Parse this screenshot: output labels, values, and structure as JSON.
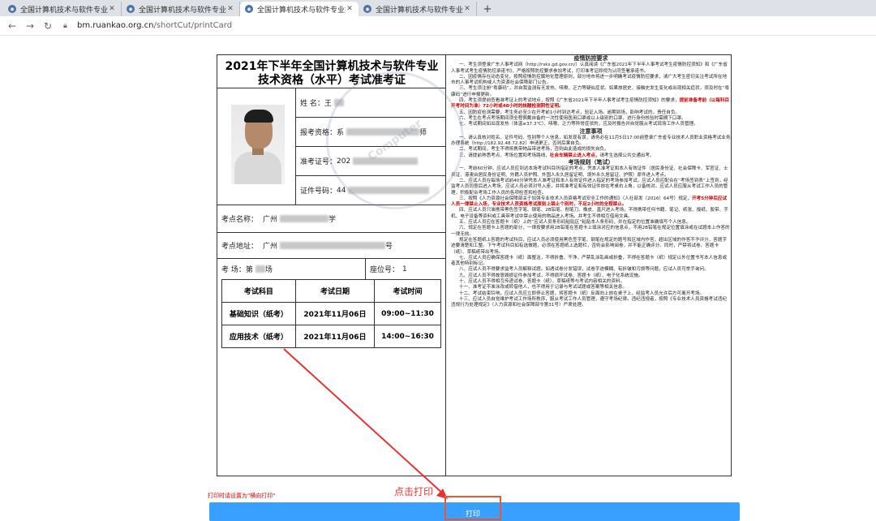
{
  "browser": {
    "tabs": [
      {
        "title": "全国计算机技术与软件专业技术"
      },
      {
        "title": "全国计算机技术与软件专业技术"
      },
      {
        "title": "全国计算机技术与软件专业技术"
      },
      {
        "title": "全国计算机技术与软件专业技术"
      }
    ],
    "new_tab": "+",
    "url_domain": "bm.ruankao.org.cn",
    "url_path": "/shortCut/printCard"
  },
  "card": {
    "title": "2021年下半年全国计算机技术与软件专业技术资格（水平）考试准考证",
    "name_label": "姓  名：",
    "name_value": "王",
    "qualification_label": "报考资格：",
    "qualification_value": "系",
    "qualification_tail": "师",
    "admission_label": "准考证号：",
    "admission_value": "202",
    "id_label": "证件号码：",
    "id_value": "44",
    "site_name_label": "考点名称：",
    "site_name_value": "广州",
    "site_name_tail": "学",
    "site_addr_label": "考点地址：",
    "site_addr_value": "广州",
    "site_addr_tail": "号",
    "room_label": "考   场：",
    "room_value": "第",
    "room_tail": "场",
    "seat_label": "座位号：",
    "seat_value": "1",
    "exam_table": {
      "headers": [
        "考试科目",
        "考试日期",
        "考试时间"
      ],
      "rows": [
        [
          "基础知识（纸考）",
          "2021年11月06日",
          "09:00~11:30"
        ],
        [
          "应用技术（纸考）",
          "2021年11月06日",
          "14:00~16:30"
        ]
      ]
    }
  },
  "notice": {
    "h1": "疫情防控要求",
    "h2": "注意事项",
    "h3": "考场规则（笔试）",
    "p1": "一、考生须登录广东人事考试网（http://rsks.gd.gov.cn/）认真阅读《广东省2021年下半年人事考试考生疫情防控须知》和《广东省人事考试考生疫情防控承诺书》，严格按照防控要求参加考试，打印准考证即视为认同签署承诺书。",
    "p2": "二、因疫情存在动态变化，按照疫情防控属地化管理原则，部分地市将进一步明确考试疫情防控要求，请广大考生密切关注考试所在地市的人事考试机构或人力资源社会保障部门公告。",
    "p3": "三、考生须注册“粤康码”，并自我监测有无发热、咳嗽、乏力等疑似症状。如果旅居史、接触史发生变化或出现相关症状，须及时在“粤康码”进行申报更新。",
    "p4": "四、考生须提前查看准考证上的考试地点，按照《广东省2021年下半年人事考试考生疫情防控须知》的要求，",
    "p4red": "提前准备考前（以每科目开考时间为准）72小时或48小时的核酸检测阴性证明。",
    "p5": "五、因防疫检测需要，考生务必至少在开考前1小时到达考点，验证入场。逾期到场，影响考试的，责任自负。",
    "p6": "六、考生在考点考场期间须全程佩戴自备的一次性使用医用口罩或以上级别的口罩，进行身份核验时需摘下口罩。",
    "p7": "七、考试期间如出现发热（体温≥37.3℃）、咳嗽、乏力等异常症状的，应及时报告并自觉服从考试现场工作人员管理。",
    "n1": "一、请认真核对姓名、证件号码、性别等个人信息，如发现有误，请务必在11月5日17:00前登录广东省专业技术人员职业资格考试业务办理系统（http://182.92.48.72.82）申请更正，否则后果自负。",
    "n2": "二、考试期间，考生不得将携带物品带进考场，否则由此造成的损失自负。",
    "n3": "三、请提前熟悉考点、考场位置和考场路线，",
    "n3red": "社会车辆禁止进入考点，",
    "n3b": "请考生选择公共交通出考。",
    "r1": "一、考前60分钟，应试人员应到达本场考试科目所指定的考点，凭本人准考证和本人有效证件（居民身份证、社会保障卡、军官证、士兵证、港澳台居民身份证明、外籍人员护照、外国人永久居留证明、境外永久居留证、护照）原件进入考点。",
    "r2": "二、应试人员在每场考试前40分钟凭本人准考证和本人有效证件进入指定的考场参加考试，应试人员应配合在“考场签到表”上签到，经监考人员同意后进入考场，应试人员必须对号入座，并将准考证和有效证件放在考桌右上角，以备核对。应试人员应服从考试工作人员的管理，积极配合考场工作人员的各项检查和检查。",
    "r3": "三、按照《人力资源社会保障部关于加强专业技术人员资格考试安全工作的通知》（人社部发〔2016〕64号）规定，",
    "r3red": "开考5分钟后应试人员一律禁止入场，专业技术人员资格考试原则上禁止个别时，不足2小时的全程禁止。",
    "r4": "四、应试人员只准携带黑色签字笔、钢笔、2B铅笔、削笔刀、橡皮、直尺进入考场，不得携带任何书籍、笔记、纸张、报纸、胶带、手机、电子设备等资料或工具带考试中禁止使用的物品进入考场。并考生不得相互借用文具。",
    "r5": "五、应试人员应在答题卡（纸）上的“应试人员条形码粘贴区”粘贴本人条形码，并在指定的位置准确填写个人信息。",
    "r6": "六、规定在答题卡上答题的部分，一律按要求用2B铅笔在答题卡上填涂对应的信息点，不用2B铅笔在规定位置填涂或在试题本上作答的一律无效。",
    "r6b": "规定在答题纸上答题的考试科目，应试人员必须使用黑色签字笔、钢笔在规定的题号和区域内作答，超出区域的作答不予评分，答题字迹要清楚和工整。下午考试科目如有选做题，必须在答题纸上选题栏，否则会影响阅卷，并不能正确评分。同时，严禁将试卷、答题卡（纸）、草稿纸带出考场。",
    "r7": "七、应试人员应确保答题卡（纸）面整洁，不得折叠、干净，严禁乱涂乱画或折叠，不得在答题卡（纸）规定以外位置书写本人信息或者其他特别标记。",
    "r8": "八、应试人员不得要求监考人员解释试题。如遇试卷分发错误，试卷字迹模糊、有折皱和污损等问题，应试人员可举手询问。",
    "r9": "九、应试人员不得故意毁损证件参加考试，不得损坏试卷、答题卡（纸）、电子化系统设施。",
    "r10": "十、应试人员不得相互传递试卷、答题卡（纸）、草稿纸等与考试内容相关的资料。",
    "r11": "十一、准考证不准涂改或转借他人，也不得用于记录与考试试题或答案等相关信息。",
    "r12": "十二、考试结束铃响，应试人员应立即停止答题，将答题卡（纸）反面向上放在桌子上，经监考人员允许后方可离开考场。",
    "r13": "十三、应试人员自觉维护考试工作场所秩序，服从考试工作人员管理，遵守考场纪律。违纪违规者，按照《专业技术人员资格考试违纪违规行为处理规定》（人力资源和社会保障部令第31号）严肃处理。"
  },
  "watermark": "Computer",
  "footer": {
    "note": "打印时请设置为\"横向打印\"",
    "click_label": "点击打印",
    "print_button": "打印"
  },
  "colors": {
    "print_bar": "#3aa0ff",
    "annotation_red": "#e33333"
  }
}
